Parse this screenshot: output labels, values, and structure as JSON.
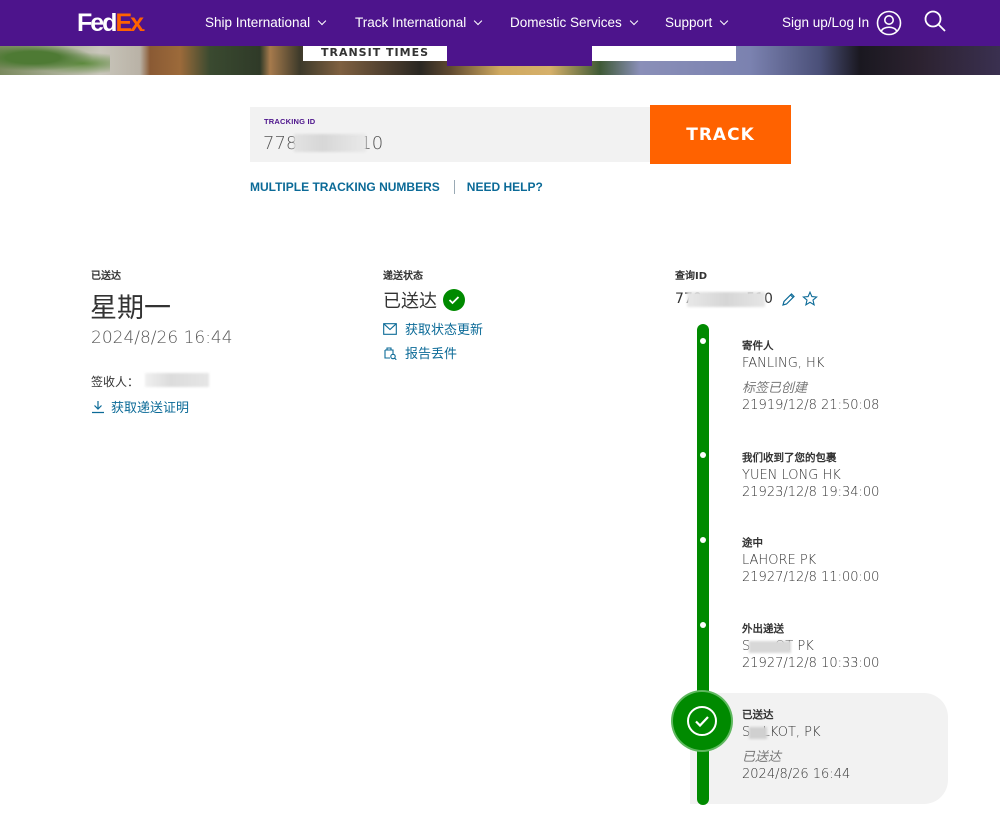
{
  "header": {
    "logo_fed": "Fed",
    "logo_ex": "Ex",
    "logo_dot": ".",
    "nav": [
      {
        "label": "Ship International"
      },
      {
        "label": "Track International"
      },
      {
        "label": "Domestic Services"
      },
      {
        "label": "Support"
      }
    ],
    "login": "Sign up/Log In",
    "brand_purple": "#4d148c",
    "brand_orange": "#ff6200"
  },
  "hero": {
    "tab_transit": "TRANSIT TIMES"
  },
  "tracking": {
    "label": "TRACKING ID",
    "value": "778         510",
    "button": "TRACK",
    "multiple_link": "MULTIPLE TRACKING NUMBERS",
    "help_link": "NEED HELP?"
  },
  "summary": {
    "delivered_label": "已送达",
    "day": "星期一",
    "datetime": "2024/8/26 16:44",
    "signer_label": "签收人：",
    "pod_link": "获取递送证明",
    "status_label": "递送状态",
    "status_value": "已送达",
    "status_updates_link": "获取状态更新",
    "report_lost_link": "报告丢件",
    "tracking_id_label": "查询ID",
    "tracking_id_value": "778          510"
  },
  "timeline": {
    "color": "#008a00",
    "events": [
      {
        "title": "寄件人",
        "location": "FANLING, HK",
        "note": "标签已创建",
        "datetime": "21919/12/8 21:50:08"
      },
      {
        "title": "我们收到了您的包裹",
        "location": "YUEN LONG HK",
        "datetime": "21923/12/8 19:34:00"
      },
      {
        "title": "途中",
        "location": "LAHORE PK",
        "datetime": "21927/12/8 11:00:00"
      },
      {
        "title": "外出递送",
        "location": "S      OT PK",
        "datetime": "21927/12/8 10:33:00"
      },
      {
        "title": "已送达",
        "location": "S   LKOT, PK",
        "note": "已送达",
        "datetime": "2024/8/26 16:44"
      }
    ]
  }
}
